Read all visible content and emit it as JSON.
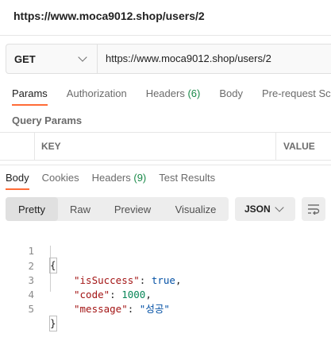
{
  "title_url": "https://www.moca9012.shop/users/2",
  "request": {
    "method": "GET",
    "url": "https://www.moca9012.shop/users/2"
  },
  "request_tabs": [
    {
      "label": "Params",
      "active": true
    },
    {
      "label": "Authorization"
    },
    {
      "label": "Headers",
      "count": "(6)"
    },
    {
      "label": "Body"
    },
    {
      "label": "Pre-request Scr"
    }
  ],
  "query_params": {
    "label": "Query Params",
    "key_header": "KEY",
    "value_header": "VALUE"
  },
  "response_tabs": [
    {
      "label": "Body",
      "active": true
    },
    {
      "label": "Cookies"
    },
    {
      "label": "Headers",
      "count": "(9)"
    },
    {
      "label": "Test Results"
    }
  ],
  "view_modes": [
    "Pretty",
    "Raw",
    "Preview",
    "Visualize"
  ],
  "active_view": "Pretty",
  "format": "JSON",
  "code": {
    "line_numbers": [
      "1",
      "2",
      "3",
      "4",
      "5"
    ],
    "open_brace": "{",
    "close_brace": "}",
    "isSuccess_key": "\"isSuccess\"",
    "isSuccess_value": "true",
    "code_key": "\"code\"",
    "code_value": "1000",
    "message_key": "\"message\"",
    "message_value": "\"성공\""
  },
  "colors": {
    "accent": "#ff6c37",
    "count": "#1a8a49",
    "json_key": "#a31515",
    "json_bool": "#0451a5",
    "json_number": "#098658"
  }
}
